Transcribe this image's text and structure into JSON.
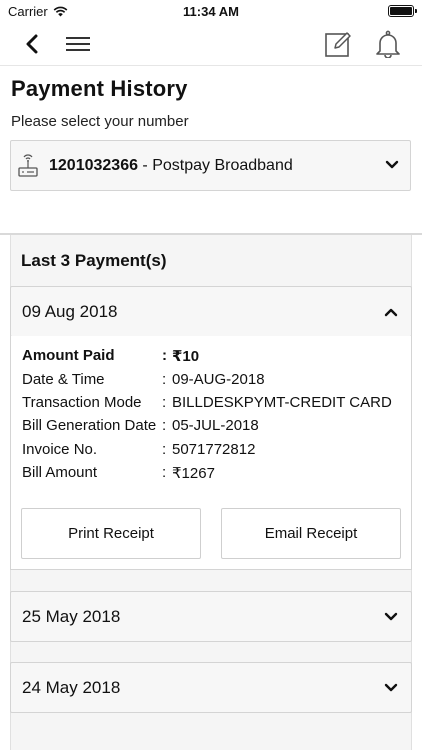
{
  "status_bar": {
    "carrier": "Carrier",
    "time": "11:34 AM"
  },
  "nav": {
    "icons": [
      "back-arrow-icon",
      "hamburger-menu-icon",
      "edit-note-icon",
      "bell-icon"
    ]
  },
  "page": {
    "title": "Payment History",
    "subtitle": "Please select your number"
  },
  "number_select": {
    "number": "1201032366",
    "plan": " - Postpay Broadband"
  },
  "history": {
    "heading": "Last 3 Payment(s)",
    "payments": [
      {
        "date": "09 Aug 2018",
        "expanded": true,
        "details": [
          {
            "label": "Amount Paid",
            "value": "₹10"
          },
          {
            "label": "Date & Time",
            "value": "09-AUG-2018"
          },
          {
            "label": "Transaction Mode",
            "value": "BILLDESKPYMT-CREDIT CARD"
          },
          {
            "label": "Bill Generation Date",
            "value": "05-JUL-2018"
          },
          {
            "label": "Invoice No.",
            "value": "5071772812"
          },
          {
            "label": "Bill Amount",
            "value": "₹1267"
          }
        ],
        "separator": ":",
        "print_label": "Print Receipt",
        "email_label": "Email Receipt"
      },
      {
        "date": "25 May 2018",
        "expanded": false
      },
      {
        "date": "24 May 2018",
        "expanded": false
      }
    ]
  },
  "colors": {
    "accent_text": "#111111",
    "panel_bg": "#f5f5f5",
    "border": "#d4d4d4"
  }
}
